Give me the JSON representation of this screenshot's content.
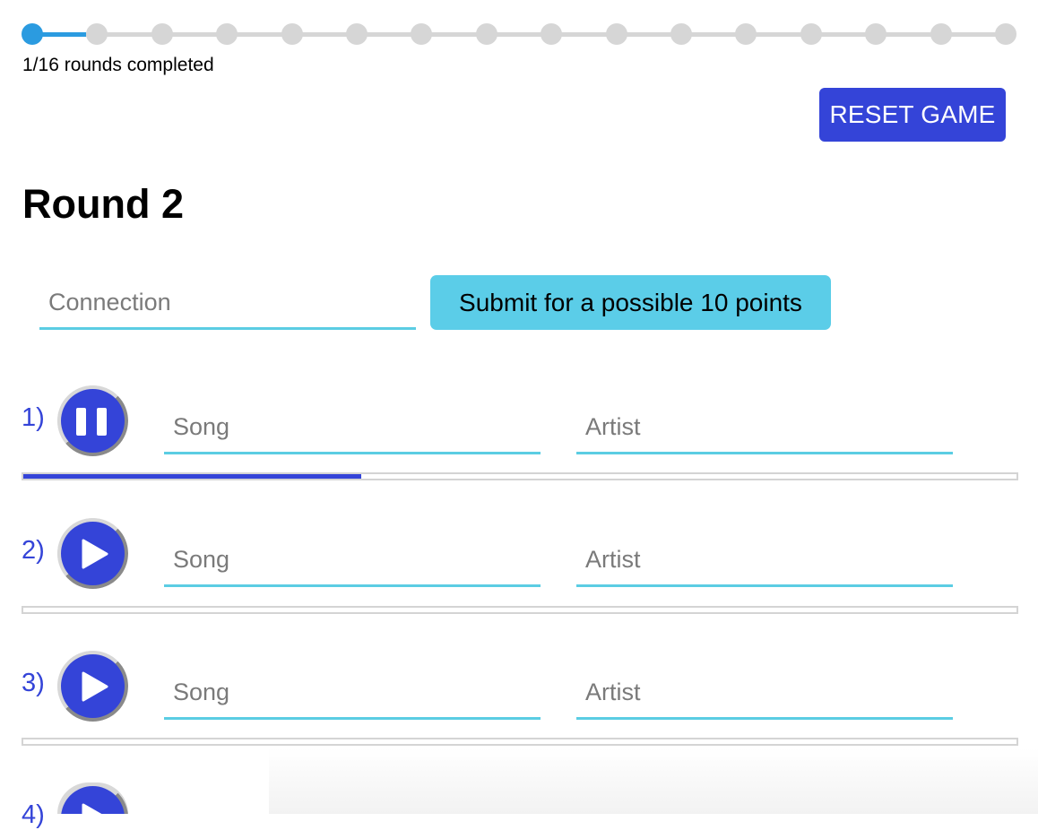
{
  "progress": {
    "text": "1/16 rounds completed",
    "completed": 1,
    "total": 16
  },
  "controls": {
    "reset_label": "RESET GAME"
  },
  "round": {
    "title": "Round 2",
    "connection_placeholder": "Connection",
    "submit_label": "Submit for a possible 10 points"
  },
  "tracks": [
    {
      "number": "1)",
      "state": "pause-icon",
      "song_placeholder": "Song",
      "artist_placeholder": "Artist",
      "playback_progress": 0.34
    },
    {
      "number": "2)",
      "state": "play-icon",
      "song_placeholder": "Song",
      "artist_placeholder": "Artist",
      "playback_progress": 0
    },
    {
      "number": "3)",
      "state": "play-icon",
      "song_placeholder": "Song",
      "artist_placeholder": "Artist",
      "playback_progress": 0
    },
    {
      "number": "4)",
      "state": "play-icon",
      "song_placeholder": "",
      "artist_placeholder": "",
      "playback_progress": 0
    }
  ],
  "colors": {
    "accent": "#3444d8",
    "stepper_done": "#2b9be0",
    "input_underline": "#5bcde3",
    "submit_bg": "#5bcde8"
  }
}
